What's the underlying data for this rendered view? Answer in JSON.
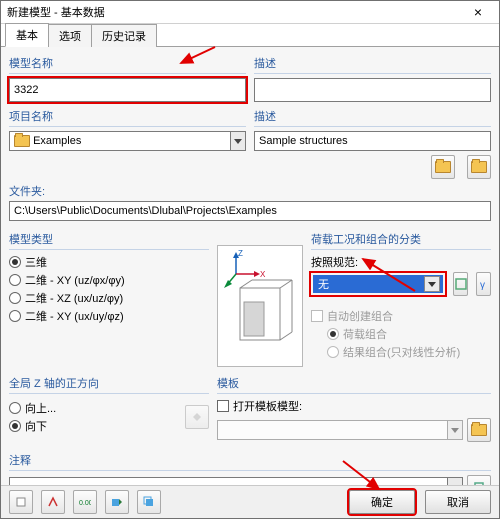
{
  "window": {
    "title": "新建模型 - 基本数据"
  },
  "tabs": {
    "basic": "基本",
    "options": "选项",
    "history": "历史记录"
  },
  "model_name": {
    "label": "模型名称",
    "value": "3322"
  },
  "description_top": {
    "label": "描述"
  },
  "project_name": {
    "label": "项目名称",
    "value": "Examples"
  },
  "project_desc": {
    "label": "描述",
    "value": "Sample structures"
  },
  "folder": {
    "label": "文件夹:",
    "value": "C:\\Users\\Public\\Documents\\Dlubal\\Projects\\Examples"
  },
  "model_type": {
    "label": "模型类型",
    "opts": {
      "o3d": "三维",
      "o2xy": "二维 - XY (uz/φx/φy)",
      "o2xz": "二维 - XZ (ux/uz/φy)",
      "o2xy2": "二维 - XY (ux/uy/φz)"
    }
  },
  "load": {
    "label": "荷载工况和组合的分类",
    "std_label": "按照规范:",
    "std_value": "无",
    "auto": "自动创建组合",
    "r1": "荷载组合",
    "r2": "结果组合(只对线性分析)"
  },
  "zaxis": {
    "label": "全局 Z 轴的正方向",
    "up": "向上...",
    "down": "向下"
  },
  "template": {
    "label": "模板",
    "open": "打开模板模型:"
  },
  "comment": {
    "label": "注释"
  },
  "buttons": {
    "ok": "确定",
    "cancel": "取消"
  }
}
